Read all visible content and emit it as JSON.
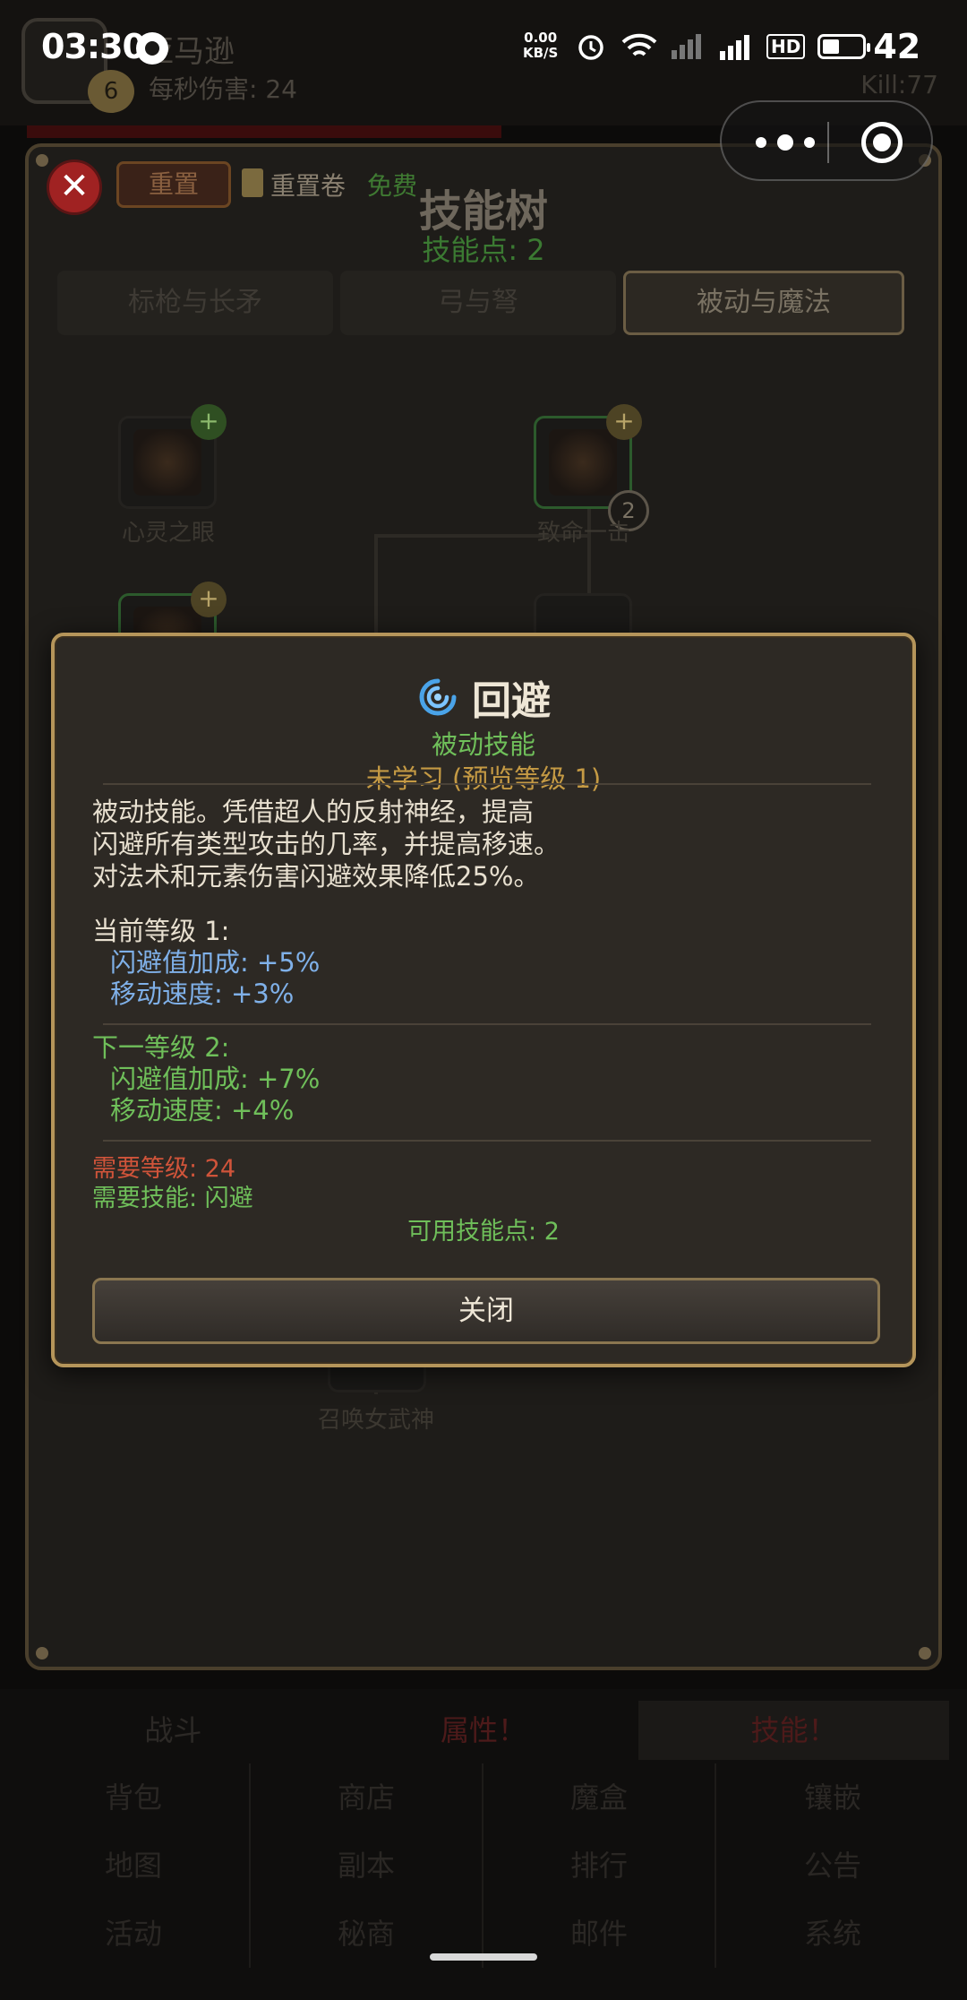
{
  "status_bar": {
    "time": "03:30",
    "net_speed_value": "0.00",
    "net_speed_unit": "KB/S",
    "network_label": "4G",
    "hd_label": "HD",
    "battery": "42"
  },
  "game_header": {
    "name": "亚马逊",
    "level": "6",
    "dps": "每秒伤害: 24",
    "kills": "Kill:77"
  },
  "skill_tree": {
    "reset_label": "重置",
    "reset_scroll_label": "重置卷",
    "free_label": "免费",
    "title": "技能树",
    "points": "技能点: 2",
    "tabs": [
      "标枪与长矛",
      "弓与弩",
      "被动与魔法"
    ],
    "active_tab": "被动与魔法",
    "nodes": {
      "inner_sight": "心灵之眼",
      "critical_strike": "致命一击",
      "critical_strike_level": "2",
      "valkyrie": "召唤女武神"
    }
  },
  "tooltip": {
    "title": "回避",
    "type": "被动技能",
    "status": "未学习 (预览等级 1)",
    "description_lines": [
      "被动技能。凭借超人的反射神经，提高",
      "闪避所有类型攻击的几率，并提高移速。",
      "对法术和元素伤害闪避效果降低25%。"
    ],
    "current": {
      "heading": "当前等级 1:",
      "stats": [
        "闪避值加成: +5%",
        "移动速度: +3%"
      ]
    },
    "next": {
      "heading": "下一等级 2:",
      "stats": [
        "闪避值加成: +7%",
        "移动速度: +4%"
      ]
    },
    "required_level": "需要等级: 24",
    "required_skill": "需要技能: 闪避",
    "available_points": "可用技能点: 2",
    "close_label": "关闭"
  },
  "bottom_nav": {
    "tabs": [
      "战斗",
      "属性！",
      "技能！"
    ],
    "menu": [
      "背包",
      "商店",
      "魔盒",
      "镶嵌",
      "地图",
      "副本",
      "排行",
      "公告",
      "活动",
      "秘商",
      "邮件",
      "系统"
    ]
  },
  "colors": {
    "accent_gold": "#b5955a",
    "text_green": "#6fbf5a",
    "text_blue": "#7fb0e8",
    "text_red": "#d0543a",
    "status_orange": "#c59a44"
  }
}
